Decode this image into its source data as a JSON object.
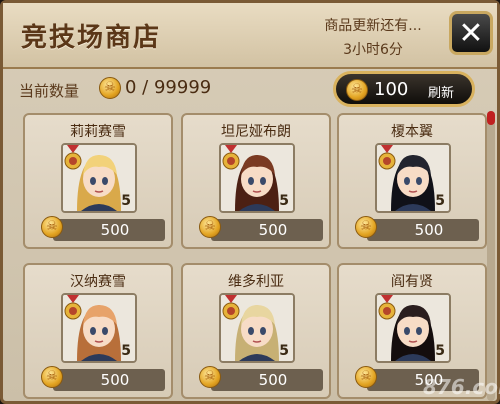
{
  "header": {
    "title": "竞技场商店",
    "refresh_hint": "商品更新还有...",
    "refresh_time": "3小时6分",
    "close_label": "✕"
  },
  "currency": {
    "label": "当前数量",
    "value": "0 / 99999"
  },
  "refresh_button": {
    "cost": "100",
    "label": "刷新"
  },
  "items": [
    {
      "name": "莉莉赛雪",
      "stars": "5",
      "price": "500",
      "hair": "#f2d27a",
      "hair_dark": "#d9a94a"
    },
    {
      "name": "坦尼娅布朗",
      "stars": "5",
      "price": "500",
      "hair": "#7a3a22",
      "hair_dark": "#4c2013"
    },
    {
      "name": "榎本翼",
      "stars": "5",
      "price": "500",
      "hair": "#22242e",
      "hair_dark": "#101118"
    },
    {
      "name": "汉纳赛雪",
      "stars": "5",
      "price": "500",
      "hair": "#e7a36a",
      "hair_dark": "#b86f3a"
    },
    {
      "name": "维多利亚",
      "stars": "5",
      "price": "500",
      "hair": "#e8d6a0",
      "hair_dark": "#c7b074"
    },
    {
      "name": "阎有贤",
      "stars": "5",
      "price": "500",
      "hair": "#2a1e1e",
      "hair_dark": "#140d0d"
    }
  ],
  "watermark": "876.com",
  "colors": {
    "accent_gold": "#d9b25e",
    "title_brown": "#5b3718",
    "scroll_thumb": "#c02020"
  }
}
